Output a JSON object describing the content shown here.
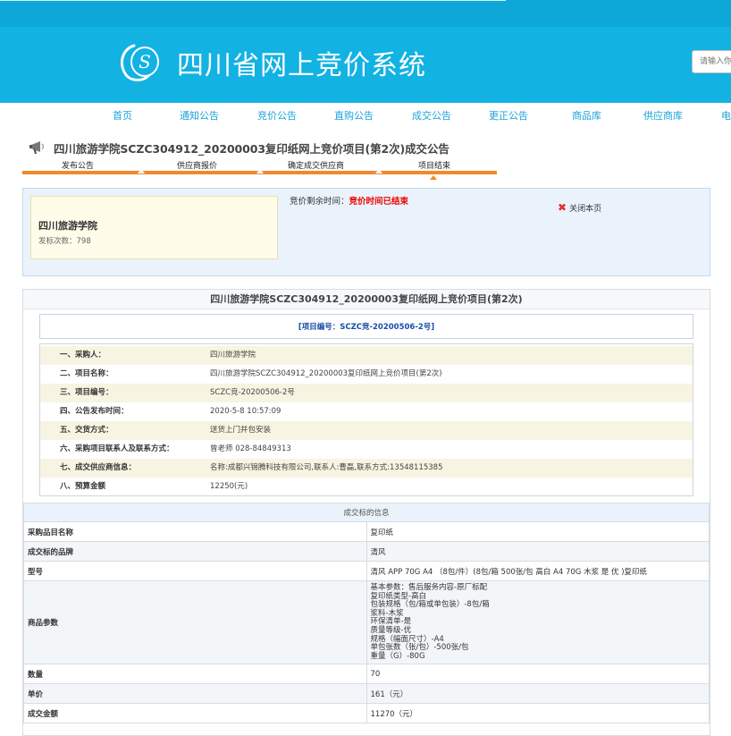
{
  "site": {
    "title": "四川省网上竞价系统",
    "search_placeholder": "请输入你"
  },
  "nav": [
    "首页",
    "通知公告",
    "竞价公告",
    "直购公告",
    "成交公告",
    "更正公告",
    "商品库",
    "供应商库",
    "电"
  ],
  "page_title": "四川旅游学院SCZC304912_20200003复印纸网上竞价项目(第2次)成交公告",
  "steps": [
    "发布公告",
    "供应商报价",
    "确定成交供应商",
    "项目结束"
  ],
  "current_step": 4,
  "buyer": {
    "name": "四川旅游学院",
    "count_label": "发标次数：",
    "count": "798"
  },
  "remain": {
    "label": "竞价剩余时间：",
    "status": "竞价时间已结束"
  },
  "close_label": "关闭本页",
  "main_title": "四川旅游学院SCZC304912_20200003复印纸网上竞价项目(第2次)",
  "project_code": "[项目编号：SCZC竞-20200506-2号]",
  "details": [
    {
      "k": "一、采购人：",
      "v": "四川旅游学院"
    },
    {
      "k": "二、项目名称：",
      "v": "四川旅游学院SCZC304912_20200003复印纸网上竞价项目(第2次)"
    },
    {
      "k": "三、项目编号：",
      "v": "SCZC竞-20200506-2号"
    },
    {
      "k": "四、公告发布时间：",
      "v": "2020-5-8 10:57:09"
    },
    {
      "k": "五、交货方式：",
      "v": "送货上门并包安装"
    },
    {
      "k": "六、采购项目联系人及联系方式：",
      "v": "曾老师    028-84849313"
    },
    {
      "k": "七、成交供应商信息：",
      "v": "名称:成都兴锦腾科技有限公司,联系人:曹磊,联系方式:13548115385"
    },
    {
      "k": "八、预算金额",
      "v": "12250(元)"
    }
  ],
  "deal": {
    "caption": "成交标的信息",
    "rows": [
      {
        "k": "采购品目名称",
        "v": "复印纸"
      },
      {
        "k": "成交标的品牌",
        "v": "清风"
      },
      {
        "k": "型号",
        "v": "清风 APP 70G A4 （8包/件）(8包/箱 500张/包 高白 A4 70G 木浆 是 优 )复印纸"
      }
    ],
    "params_label": "商品参数",
    "params": [
      "基本参数：售后服务内容-原厂标配",
      "复印纸类型-高白",
      "包装规格（包/箱或单包装）-8包/箱",
      "浆料-木浆",
      "环保清单-是",
      "质量等级-优",
      "规格（幅面尺寸）-A4",
      "单包张数（张/包）-500张/包",
      "重量（G）-80G"
    ],
    "rows2": [
      {
        "k": "数量",
        "v": "70"
      },
      {
        "k": "单价",
        "v": "161（元）"
      },
      {
        "k": "成交金额",
        "v": "11270（元）"
      }
    ]
  }
}
